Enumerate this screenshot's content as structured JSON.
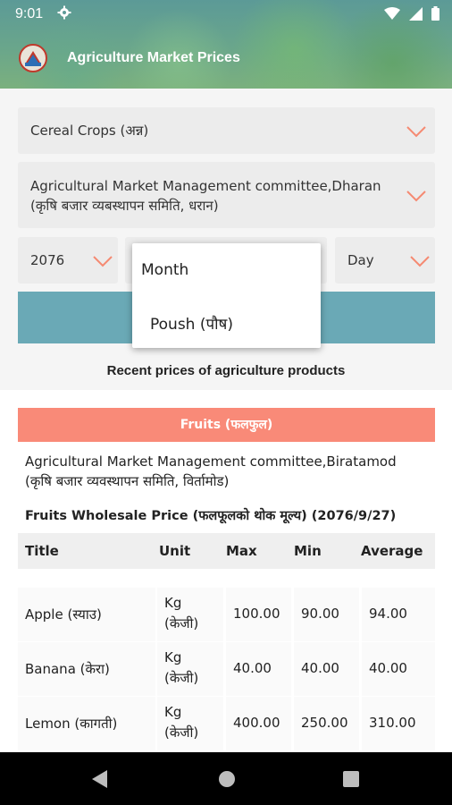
{
  "status_bar": {
    "time": "9:01"
  },
  "app": {
    "title": "Agriculture Market Prices"
  },
  "filters": {
    "category": "Cereal Crops (अन्न)",
    "market_line1": "Agricultural  Market Management committee,Dharan",
    "market_line2": "(कृषि बजार व्यबस्थापन समिति, धरान)",
    "year": "2076",
    "day": "Day"
  },
  "month_dropdown": {
    "options": [
      "Month",
      "Poush (पौष)"
    ]
  },
  "section_title": "Recent prices of agriculture products",
  "category_bar": "Fruits (फलफुल)",
  "listing": {
    "market_line1": "Agricultural  Market Management committee,Biratamod",
    "market_line2": "(कृषि बजार व्यवस्थापन समिति, विर्तामोड)",
    "heading": "Fruits Wholesale Price (फलफूलको थोक मूल्य) (2076/9/27)"
  },
  "table": {
    "headers": [
      "Title",
      "Unit",
      "Max",
      "Min",
      "Average"
    ],
    "rows": [
      {
        "title": "Apple (स्याउ)",
        "unit1": "Kg",
        "unit2": "(केजी)",
        "max": "100.00",
        "min": "90.00",
        "avg": "94.00"
      },
      {
        "title": "Banana (केरा)",
        "unit1": "Kg",
        "unit2": "(केजी)",
        "max": "40.00",
        "min": "40.00",
        "avg": "40.00"
      },
      {
        "title": "Lemon (कागती)",
        "unit1": "Kg",
        "unit2": "(केजी)",
        "max": "400.00",
        "min": "250.00",
        "avg": "310.00"
      }
    ]
  },
  "colors": {
    "accent_chevron": "#f58a72",
    "category_bar": "#f98a78",
    "search_button": "#6aa9b6"
  },
  "icons": [
    "settings-icon",
    "wifi-icon",
    "signal-icon",
    "battery-icon",
    "chevron-down-icon",
    "back-icon",
    "home-icon",
    "recents-icon"
  ]
}
